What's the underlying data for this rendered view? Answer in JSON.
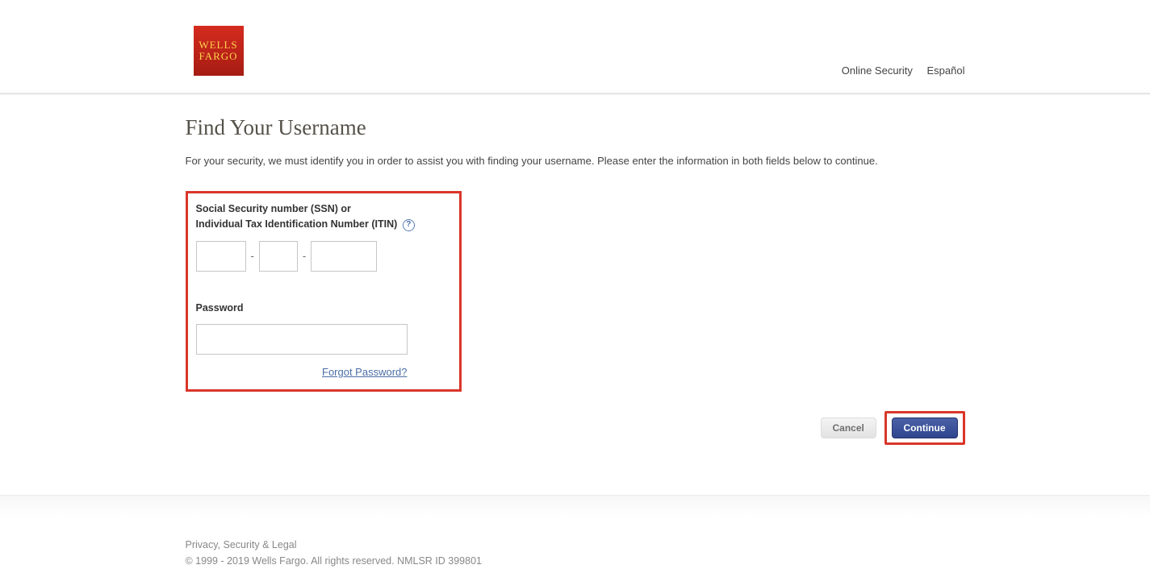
{
  "header": {
    "logo_line1": "WELLS",
    "logo_line2": "FARGO",
    "links": {
      "online_security": "Online Security",
      "espanol": "Español"
    }
  },
  "page": {
    "title": "Find Your Username",
    "intro": "For your security, we must identify you in order to assist you with finding your username. Please enter the information in both fields below to continue."
  },
  "form": {
    "ssn_label_line1": "Social Security number (SSN) or",
    "ssn_label_line2": "Individual Tax Identification Number (ITIN)",
    "help_symbol": "?",
    "separator": "-",
    "password_label": "Password",
    "forgot_password": "Forgot Password?"
  },
  "buttons": {
    "cancel": "Cancel",
    "continue": "Continue"
  },
  "footer": {
    "legal_link": "Privacy, Security & Legal",
    "copyright": "© 1999 - 2019 Wells Fargo. All rights reserved. NMLSR ID 399801"
  }
}
